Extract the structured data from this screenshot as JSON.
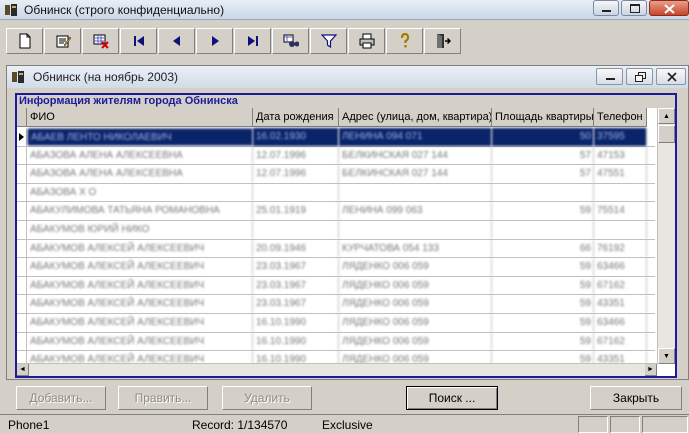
{
  "window": {
    "title": "Обнинск (строго конфиденциально)"
  },
  "toolbar": {
    "buttons": [
      {
        "name": "new-document-icon"
      },
      {
        "name": "edit-record-icon"
      },
      {
        "name": "delete-record-icon"
      },
      {
        "name": "first-record-icon"
      },
      {
        "name": "prior-record-icon"
      },
      {
        "name": "next-record-icon"
      },
      {
        "name": "last-record-icon"
      },
      {
        "name": "search-binoculars-icon"
      },
      {
        "name": "filter-icon"
      },
      {
        "name": "print-icon"
      },
      {
        "name": "help-icon"
      },
      {
        "name": "exit-door-icon"
      }
    ]
  },
  "child": {
    "title": "Обнинск (на ноябрь 2003)"
  },
  "grid": {
    "caption": "Информация жителям города Обнинска",
    "columns": [
      "ФИО",
      "Дата рождения",
      "Адрес (улица, дом, квартира)",
      "Площадь квартиры",
      "Телефон"
    ],
    "rows": [
      [
        "АБАЕВ ЛЕНТО НИКОЛАЕВИЧ",
        "16.02.1930",
        "ЛЕНИНА 094 071",
        "50",
        "37595"
      ],
      [
        "АБАЗОВА АЛЕНА АЛЕКСЕЕВНА",
        "12.07.1996",
        "БЕЛКИНСКАЯ 027 144",
        "57",
        "47153"
      ],
      [
        "АБАЗОВА АЛЕНА АЛЕКСЕЕВНА",
        "12.07.1996",
        "БЕЛКИНСКАЯ 027 144",
        "57",
        "47551"
      ],
      [
        "АБАЗОВА Х О",
        "",
        "",
        "",
        ""
      ],
      [
        "АБАКУЛИМОВА ТАТЬЯНА РОМАНОВНА",
        "25.01.1919",
        "ЛЕНИНА 099 063",
        "59",
        "75514"
      ],
      [
        "АБАКУМОВ ЮРИЙ НИКО",
        "",
        "",
        "",
        ""
      ],
      [
        "АБАКУМОВ АЛЕКСЕЙ АЛЕКСЕЕВИЧ",
        "20.09.1946",
        "КУРЧАТОВА 054 133",
        "66",
        "76192"
      ],
      [
        "АБАКУМОВ АЛЕКСЕЙ АЛЕКСЕЕВИЧ",
        "23.03.1967",
        "ЛЯДЕНКО 006 059",
        "59",
        "63466"
      ],
      [
        "АБАКУМОВ АЛЕКСЕЙ АЛЕКСЕЕВИЧ",
        "23.03.1967",
        "ЛЯДЕНКО 006 059",
        "59",
        "67162"
      ],
      [
        "АБАКУМОВ АЛЕКСЕЙ АЛЕКСЕЕВИЧ",
        "23.03.1967",
        "ЛЯДЕНКО 006 059",
        "59",
        "43351"
      ],
      [
        "АБАКУМОВ АЛЕКСЕЙ АЛЕКСЕЕВИЧ",
        "16.10.1990",
        "ЛЯДЕНКО 006 059",
        "59",
        "63466"
      ],
      [
        "АБАКУМОВ АЛЕКСЕЙ АЛЕКСЕЕВИЧ",
        "16.10.1990",
        "ЛЯДЕНКО 006 059",
        "59",
        "67162"
      ],
      [
        "АБАКУМОВ АЛЕКСЕЙ АЛЕКСЕЕВИЧ",
        "16.10.1990",
        "ЛЯДЕНКО 006 059",
        "59",
        "43351"
      ]
    ]
  },
  "buttons": {
    "add": "Добавить...",
    "edit": "Править...",
    "delete": "Удалить",
    "search": "Поиск ...",
    "close": "Закрыть"
  },
  "status": {
    "db": "Phone1",
    "record": "Record: 1/134570",
    "mode": "Exclusive"
  }
}
